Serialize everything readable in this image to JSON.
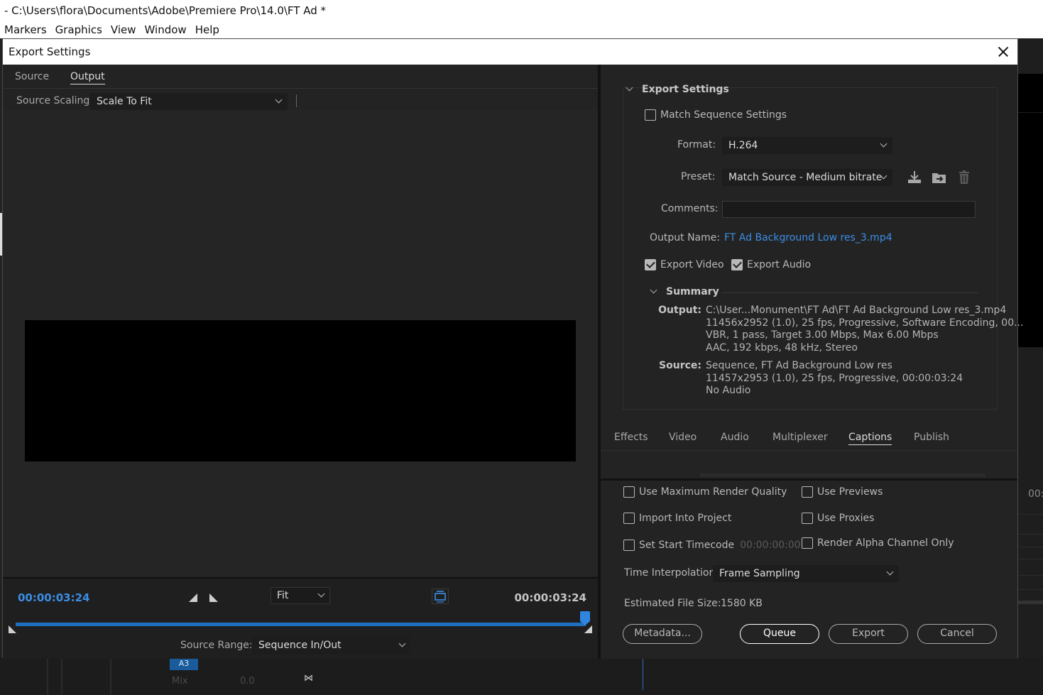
{
  "app": {
    "title": "- C:\\Users\\flora\\Documents\\Adobe\\Premiere Pro\\14.0\\FT Ad *",
    "menu": [
      "Markers",
      "Graphics",
      "View",
      "Window",
      "Help"
    ],
    "right_time": "00:",
    "track_mix_label": "Mix",
    "track_mix_value": "0.0",
    "track_a3": "A3"
  },
  "dialog": {
    "title": "Export Settings",
    "left_tabs": [
      "Source",
      "Output"
    ],
    "source_scaling_label": "Source Scaling:",
    "source_scaling_value": "Scale To Fit",
    "timecode_in": "00:00:03:24",
    "timecode_out": "00:00:03:24",
    "fit_value": "Fit",
    "source_range_label": "Source Range:",
    "source_range_value": "Sequence In/Out"
  },
  "export_settings": {
    "header": "Export Settings",
    "match_sequence": {
      "label": "Match Sequence Settings",
      "checked": false
    },
    "format_label": "Format:",
    "format_value": "H.264",
    "preset_label": "Preset:",
    "preset_value": "Match Source - Medium bitrate",
    "comments_label": "Comments:",
    "comments_value": "",
    "output_name_label": "Output Name:",
    "output_name_value": "FT Ad Background Low res_3.mp4",
    "export_video": {
      "label": "Export Video",
      "checked": true
    },
    "export_audio": {
      "label": "Export Audio",
      "checked": true
    }
  },
  "summary": {
    "header": "Summary",
    "output_key": "Output:",
    "output_lines": [
      "C:\\User...Monument\\FT Ad\\FT Ad Background Low res_3.mp4",
      "11456x2952 (1.0), 25 fps, Progressive, Software Encoding, 00...",
      "VBR, 1 pass, Target 3.00 Mbps, Max 6.00 Mbps",
      "AAC, 192 kbps, 48 kHz, Stereo"
    ],
    "source_key": "Source:",
    "source_lines": [
      "Sequence, FT Ad Background Low res",
      "11457x2953 (1.0), 25 fps, Progressive, 00:00:03:24",
      "No Audio"
    ]
  },
  "bottom_tabs": [
    "Effects",
    "Video",
    "Audio",
    "Multiplexer",
    "Captions",
    "Publish"
  ],
  "active_bottom_tab": "Captions",
  "options": {
    "max_render_quality": "Use Maximum Render Quality",
    "use_previews": "Use Previews",
    "import_into_project": "Import Into Project",
    "use_proxies": "Use Proxies",
    "set_start_timecode": "Set Start Timecode",
    "start_timecode_value": "00:00:00:00",
    "render_alpha_only": "Render Alpha Channel Only"
  },
  "time_interpolation": {
    "label": "Time Interpolation:",
    "value": "Frame Sampling"
  },
  "estimated_file_size": {
    "label": "Estimated File Size:",
    "value": "1580 KB"
  },
  "buttons": {
    "metadata": "Metadata...",
    "queue": "Queue",
    "export": "Export",
    "cancel": "Cancel"
  },
  "colors": {
    "accent": "#3a8ee6",
    "timeline": "#1f6fbf",
    "bg": "#232323"
  }
}
